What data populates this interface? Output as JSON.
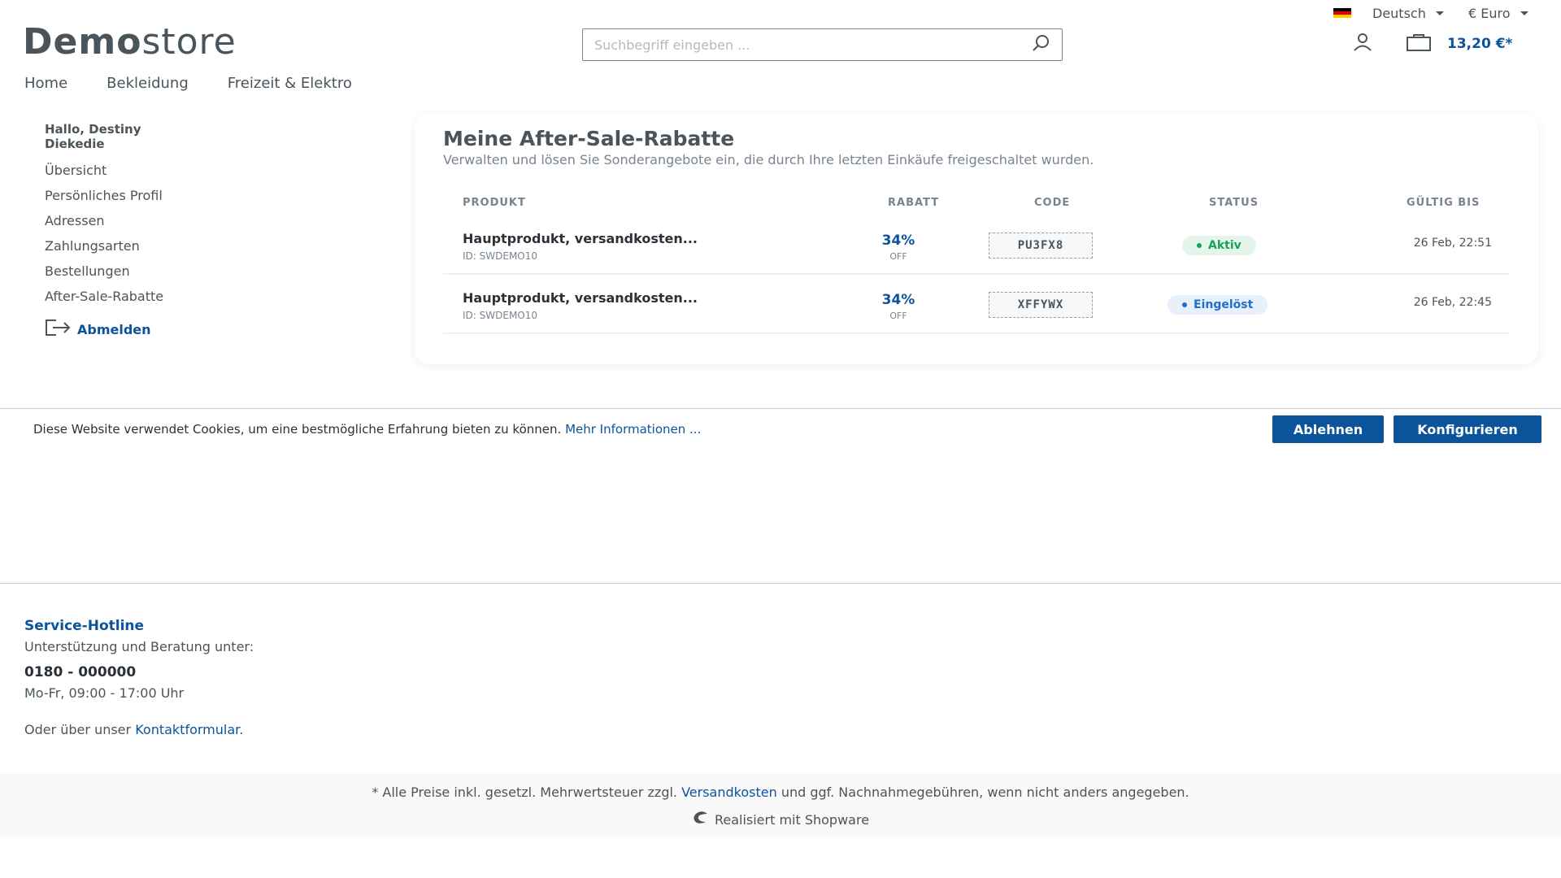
{
  "topbar": {
    "language": "Deutsch",
    "currency": "€ Euro"
  },
  "logo": {
    "bold": "Demo",
    "light": "store"
  },
  "search": {
    "placeholder": "Suchbegriff eingeben ..."
  },
  "cart": {
    "total": "13,20 €*"
  },
  "nav": {
    "items": [
      "Home",
      "Bekleidung",
      "Freizeit & Elektro"
    ]
  },
  "sidebar": {
    "greeting_line1": "Hallo, Destiny",
    "greeting_line2": "Diekedie",
    "items": [
      "Übersicht",
      "Persönliches Profil",
      "Adressen",
      "Zahlungsarten",
      "Bestellungen",
      "After-Sale-Rabatte"
    ],
    "logout": "Abmelden"
  },
  "discounts": {
    "title": "Meine After-Sale-Rabatte",
    "subtitle": "Verwalten und lösen Sie Sonderangebote ein, die durch Ihre letzten Einkäufe freigeschaltet wurden.",
    "columns": [
      "PRODUKT",
      "RABATT",
      "CODE",
      "STATUS",
      "GÜLTIG BIS"
    ],
    "rows": [
      {
        "product": "Hauptprodukt, versandkosten...",
        "id": "ID: SWDEMO10",
        "percent": "34%",
        "off": "OFF",
        "code": "PU3FX8",
        "status": "Aktiv",
        "valid_until": "26 Feb, 22:51"
      },
      {
        "product": "Hauptprodukt, versandkosten...",
        "id": "ID: SWDEMO10",
        "percent": "34%",
        "off": "OFF",
        "code": "XFFYWX",
        "status": "Eingelöst",
        "valid_until": "26 Feb, 22:45"
      }
    ]
  },
  "cookie": {
    "text": "Diese Website verwendet Cookies, um eine bestmögliche Erfahrung bieten zu können.",
    "link": "Mehr Informationen ...",
    "decline": "Ablehnen",
    "configure": "Konfigurieren"
  },
  "footer": {
    "hotline_title": "Service-Hotline",
    "support_text": "Unterstützung und Beratung unter:",
    "phone": "0180 - 000000",
    "hours": "Mo-Fr, 09:00 - 17:00 Uhr",
    "contact_prefix": "Oder über unser",
    "contact_link": "Kontaktformular",
    "contact_suffix": ".",
    "vat_prefix": "* Alle Preise inkl. gesetzl. Mehrwertsteuer zzgl.",
    "vat_link": "Versandkosten",
    "vat_suffix": "und ggf. Nachnahmegebühren, wenn nicht anders angegeben.",
    "powered": "Realisiert mit Shopware"
  },
  "colors": {
    "accent": "#0b539b",
    "text": "#4a545b",
    "active": "#1e9e57",
    "redeemed": "#1f6fc5"
  }
}
